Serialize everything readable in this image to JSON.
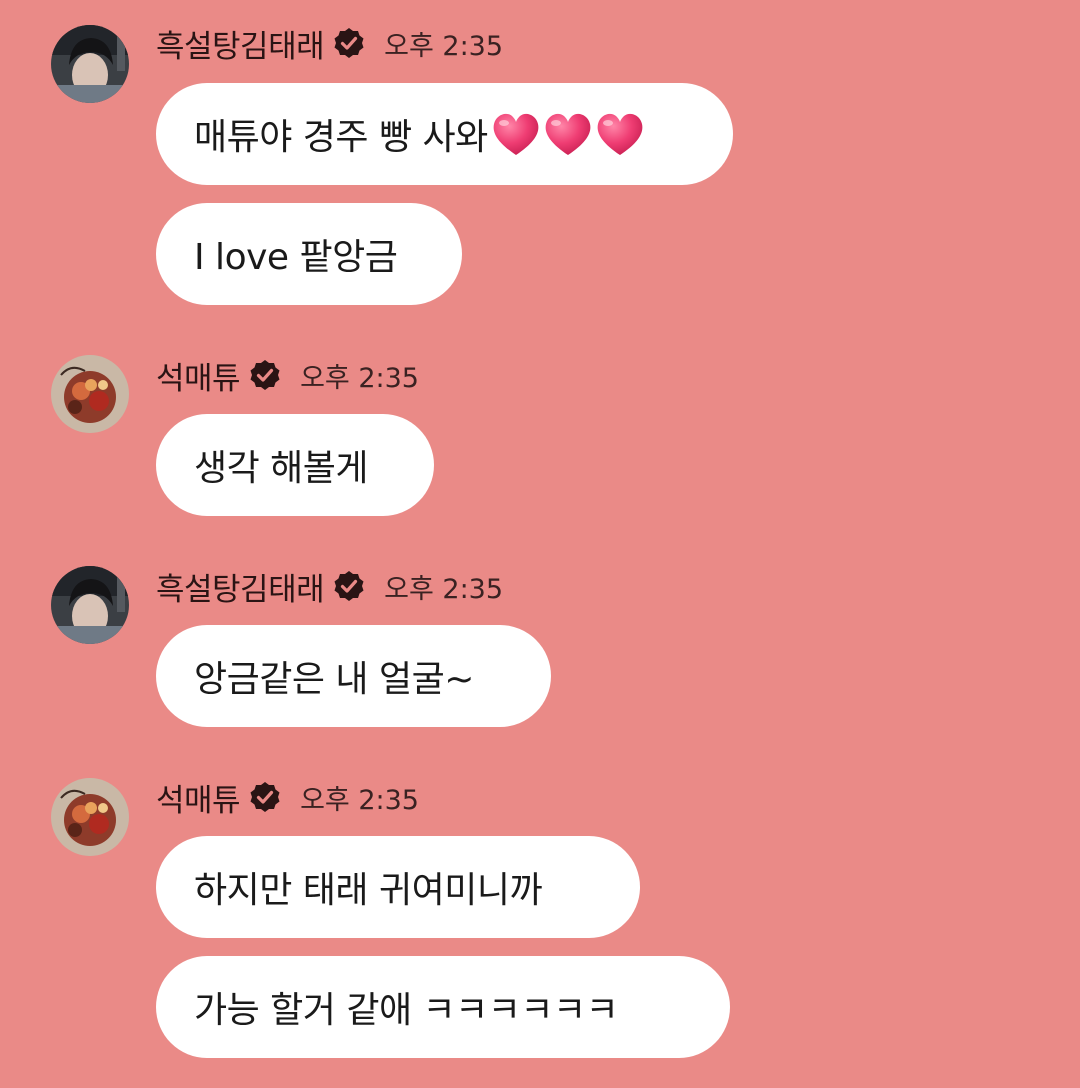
{
  "colors": {
    "background": "#ea8a87",
    "bubble": "#ffffff",
    "heart": "#e8336a"
  },
  "messages": [
    {
      "sender": "흑설탕김태래",
      "verified": true,
      "time": "오후 2:35",
      "avatar": "avatar-taerae",
      "bubbles": [
        {
          "text": "매튜야 경주 빵 사와",
          "emoji": [
            "red-heart",
            "red-heart",
            "red-heart"
          ]
        },
        {
          "text": "I love 팥앙금"
        }
      ]
    },
    {
      "sender": "석매튜",
      "verified": true,
      "time": "오후 2:35",
      "avatar": "avatar-matthew",
      "bubbles": [
        {
          "text": "생각 해볼게"
        }
      ]
    },
    {
      "sender": "흑설탕김태래",
      "verified": true,
      "time": "오후 2:35",
      "avatar": "avatar-taerae",
      "bubbles": [
        {
          "text": "앙금같은 내 얼굴~"
        }
      ]
    },
    {
      "sender": "석매튜",
      "verified": true,
      "time": "오후 2:35",
      "avatar": "avatar-matthew",
      "bubbles": [
        {
          "text": "하지만 태래 귀여미니까"
        },
        {
          "text": "가능 할거 같애 ㅋㅋㅋㅋㅋㅋ"
        }
      ]
    }
  ]
}
